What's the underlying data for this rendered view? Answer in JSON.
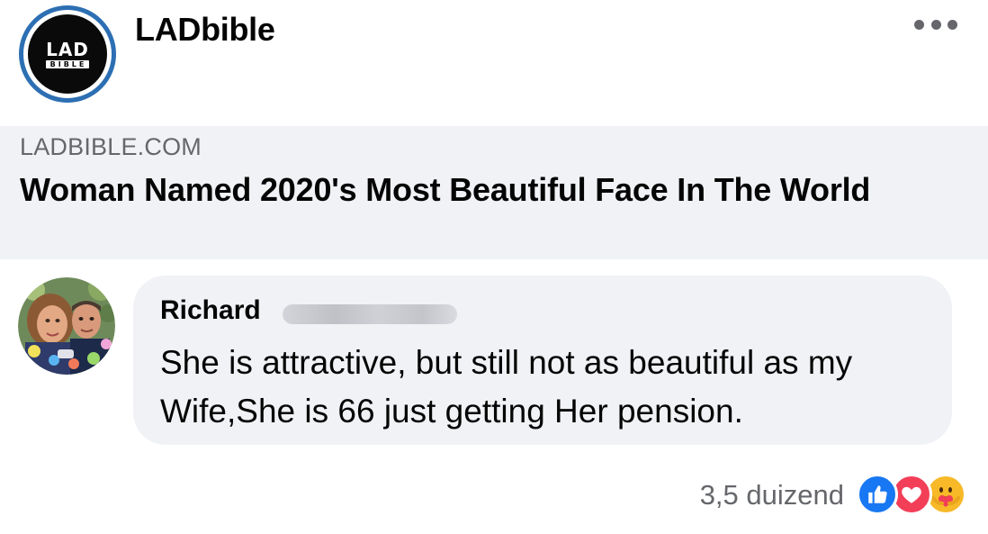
{
  "post": {
    "page_name": "LADbible",
    "logo": {
      "text_top": "LAD",
      "text_bottom": "BIBLE",
      "ring_color": "#2d6fb3"
    },
    "more_icon": "ellipsis-icon"
  },
  "link_preview": {
    "domain": "LADBIBLE.COM",
    "title": "Woman Named 2020's Most Beautiful Face In The World"
  },
  "comment": {
    "author_first_name": "Richard",
    "author_last_name_obscured": true,
    "text": "She is attractive, but still not as beautiful as my Wife,She is 66 just getting Her pension."
  },
  "reactions": {
    "count": "3,5 duizend",
    "types": [
      "like-icon",
      "love-icon",
      "care-icon"
    ],
    "colors": {
      "like": "#1877f2",
      "love": "#f33e58",
      "care": "#f7b928"
    }
  }
}
